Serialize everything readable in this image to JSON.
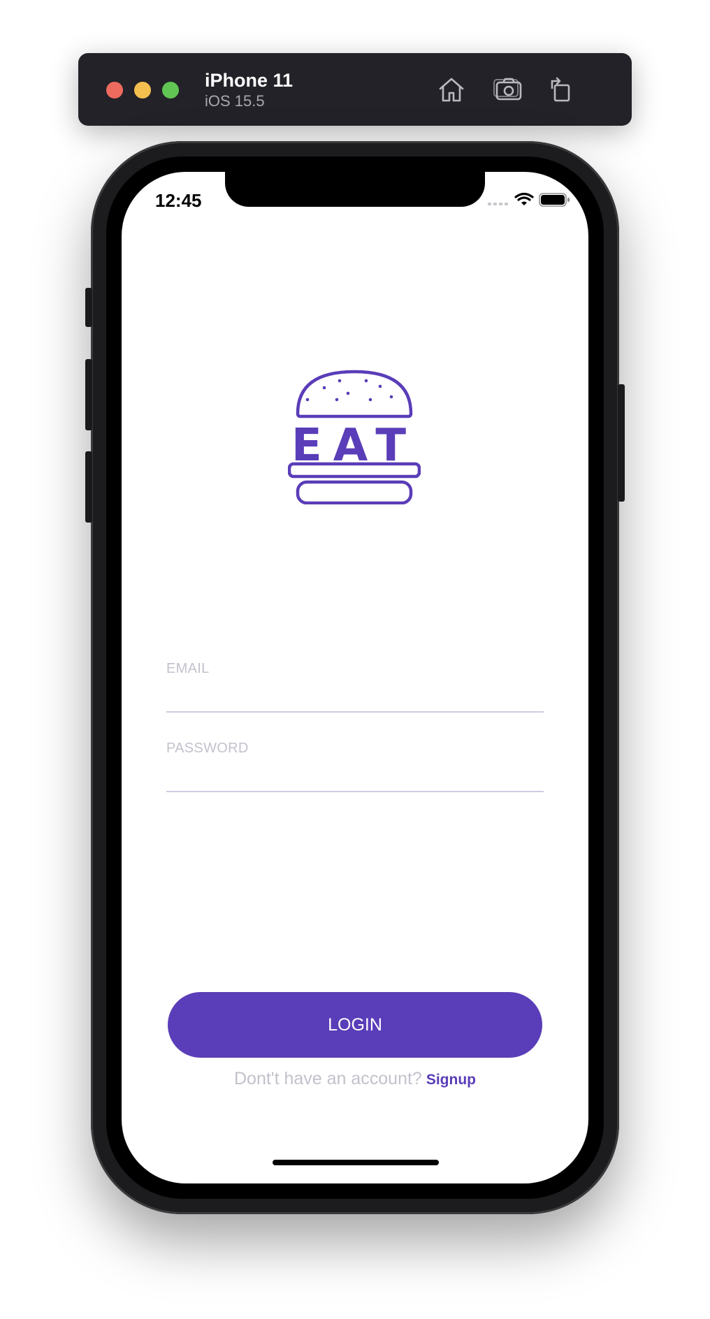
{
  "simulator": {
    "device_name": "iPhone 11",
    "os_version": "iOS 15.5",
    "toolbar_icons": [
      "home-icon",
      "screenshot-icon",
      "rotate-icon"
    ]
  },
  "status_bar": {
    "time": "12:45"
  },
  "logo": {
    "text": "EAT",
    "color": "#5a3db8"
  },
  "form": {
    "email_label": "EMAIL",
    "password_label": "PASSWORD",
    "login_label": "LOGIN"
  },
  "footer": {
    "prompt": "Dont't have an account?",
    "signup_label": "Signup"
  },
  "colors": {
    "accent": "#5a3db8",
    "muted_text": "#c3c1cc"
  }
}
